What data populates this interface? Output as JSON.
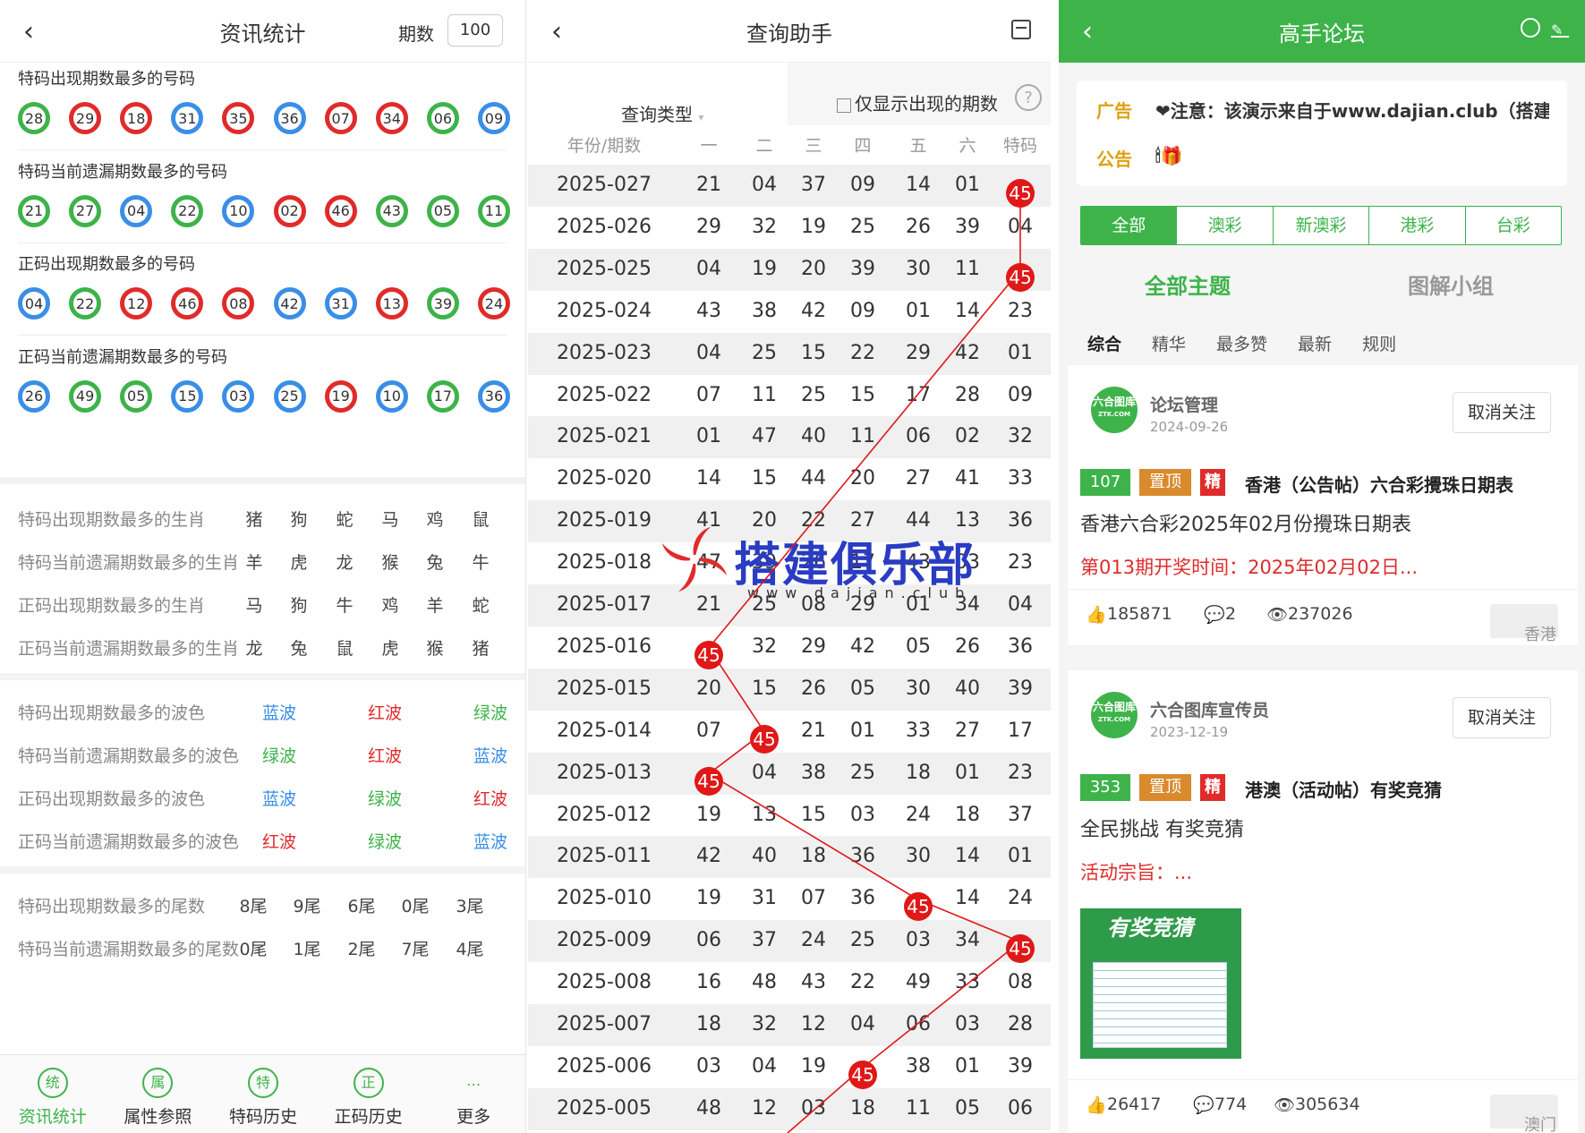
{
  "panel1": {
    "title": "资讯统计",
    "qishu_label": "期数",
    "qishu_value": "100",
    "ball_sections": [
      {
        "title": "特码出现期数最多的号码",
        "balls": [
          [
            "28",
            "green"
          ],
          [
            "29",
            "red"
          ],
          [
            "18",
            "red"
          ],
          [
            "31",
            "blue"
          ],
          [
            "35",
            "red"
          ],
          [
            "36",
            "blue"
          ],
          [
            "07",
            "red"
          ],
          [
            "34",
            "red"
          ],
          [
            "06",
            "green"
          ],
          [
            "09",
            "blue"
          ]
        ]
      },
      {
        "title": "特码当前遗漏期数最多的号码",
        "balls": [
          [
            "21",
            "green"
          ],
          [
            "27",
            "green"
          ],
          [
            "04",
            "blue"
          ],
          [
            "22",
            "green"
          ],
          [
            "10",
            "blue"
          ],
          [
            "02",
            "red"
          ],
          [
            "46",
            "red"
          ],
          [
            "43",
            "green"
          ],
          [
            "05",
            "green"
          ],
          [
            "11",
            "green"
          ]
        ]
      },
      {
        "title": "正码出现期数最多的号码",
        "balls": [
          [
            "04",
            "blue"
          ],
          [
            "22",
            "green"
          ],
          [
            "12",
            "red"
          ],
          [
            "46",
            "red"
          ],
          [
            "08",
            "red"
          ],
          [
            "42",
            "blue"
          ],
          [
            "31",
            "blue"
          ],
          [
            "13",
            "red"
          ],
          [
            "39",
            "green"
          ],
          [
            "24",
            "red"
          ]
        ]
      },
      {
        "title": "正码当前遗漏期数最多的号码",
        "balls": [
          [
            "26",
            "blue"
          ],
          [
            "49",
            "green"
          ],
          [
            "05",
            "green"
          ],
          [
            "15",
            "blue"
          ],
          [
            "03",
            "blue"
          ],
          [
            "25",
            "blue"
          ],
          [
            "19",
            "red"
          ],
          [
            "10",
            "blue"
          ],
          [
            "17",
            "green"
          ],
          [
            "36",
            "blue"
          ]
        ]
      }
    ],
    "zodiac": [
      {
        "label": "特码出现期数最多的生肖",
        "values": [
          "猪",
          "狗",
          "蛇",
          "马",
          "鸡",
          "鼠"
        ]
      },
      {
        "label": "特码当前遗漏期数最多的生肖",
        "values": [
          "羊",
          "虎",
          "龙",
          "猴",
          "兔",
          "牛"
        ]
      },
      {
        "label": "正码出现期数最多的生肖",
        "values": [
          "马",
          "狗",
          "牛",
          "鸡",
          "羊",
          "蛇"
        ]
      },
      {
        "label": "正码当前遗漏期数最多的生肖",
        "values": [
          "龙",
          "兔",
          "鼠",
          "虎",
          "猴",
          "猪"
        ]
      }
    ],
    "waves": [
      {
        "label": "特码出现期数最多的波色",
        "values": [
          [
            "蓝波",
            "blue"
          ],
          [
            "红波",
            "red"
          ],
          [
            "绿波",
            "green"
          ]
        ]
      },
      {
        "label": "特码当前遗漏期数最多的波色",
        "values": [
          [
            "绿波",
            "green"
          ],
          [
            "红波",
            "red"
          ],
          [
            "蓝波",
            "blue"
          ]
        ]
      },
      {
        "label": "正码出现期数最多的波色",
        "values": [
          [
            "蓝波",
            "blue"
          ],
          [
            "绿波",
            "green"
          ],
          [
            "红波",
            "red"
          ]
        ]
      },
      {
        "label": "正码当前遗漏期数最多的波色",
        "values": [
          [
            "红波",
            "red"
          ],
          [
            "绿波",
            "green"
          ],
          [
            "蓝波",
            "blue"
          ]
        ]
      }
    ],
    "tails": [
      {
        "label": "特码出现期数最多的尾数",
        "values": [
          "8尾",
          "9尾",
          "6尾",
          "0尾",
          "3尾"
        ]
      },
      {
        "label": "特码当前遗漏期数最多的尾数",
        "values": [
          "0尾",
          "1尾",
          "2尾",
          "7尾",
          "4尾"
        ]
      }
    ],
    "bottom_nav": [
      {
        "icon": "统",
        "label": "资讯统计"
      },
      {
        "icon": "属",
        "label": "属性参照"
      },
      {
        "icon": "特",
        "label": "特码历史"
      },
      {
        "icon": "正",
        "label": "正码历史"
      },
      {
        "icon": "…",
        "label": "更多"
      }
    ]
  },
  "panel2": {
    "title": "查询助手",
    "query_type": "查询类型",
    "checkbox_label": "仅显示出现的期数",
    "help": "?",
    "headers": [
      "年份/期数",
      "一",
      "二",
      "三",
      "四",
      "五",
      "六",
      "特码"
    ],
    "highlight": "45",
    "rows": [
      [
        "2025-027",
        "21",
        "04",
        "37",
        "09",
        "14",
        "01",
        "45"
      ],
      [
        "2025-026",
        "29",
        "32",
        "19",
        "25",
        "26",
        "39",
        "04"
      ],
      [
        "2025-025",
        "04",
        "19",
        "20",
        "39",
        "30",
        "11",
        "45"
      ],
      [
        "2025-024",
        "43",
        "38",
        "42",
        "09",
        "01",
        "14",
        "23"
      ],
      [
        "2025-023",
        "04",
        "25",
        "15",
        "22",
        "29",
        "42",
        "01"
      ],
      [
        "2025-022",
        "07",
        "11",
        "25",
        "15",
        "17",
        "28",
        "09"
      ],
      [
        "2025-021",
        "01",
        "47",
        "40",
        "11",
        "06",
        "02",
        "32"
      ],
      [
        "2025-020",
        "14",
        "15",
        "44",
        "20",
        "27",
        "41",
        "33"
      ],
      [
        "2025-019",
        "41",
        "20",
        "22",
        "27",
        "44",
        "13",
        "36"
      ],
      [
        "2025-018",
        "47",
        "39",
        "26",
        "17",
        "43",
        "03",
        "23"
      ],
      [
        "2025-017",
        "21",
        "25",
        "08",
        "29",
        "01",
        "34",
        "04"
      ],
      [
        "2025-016",
        "45",
        "32",
        "29",
        "42",
        "05",
        "26",
        "36"
      ],
      [
        "2025-015",
        "20",
        "15",
        "26",
        "05",
        "30",
        "40",
        "39"
      ],
      [
        "2025-014",
        "07",
        "45",
        "21",
        "01",
        "33",
        "27",
        "17"
      ],
      [
        "2025-013",
        "45",
        "04",
        "38",
        "25",
        "18",
        "01",
        "23"
      ],
      [
        "2025-012",
        "19",
        "13",
        "15",
        "03",
        "24",
        "18",
        "37"
      ],
      [
        "2025-011",
        "42",
        "40",
        "18",
        "36",
        "30",
        "14",
        "01"
      ],
      [
        "2025-010",
        "19",
        "31",
        "07",
        "36",
        "45",
        "14",
        "24"
      ],
      [
        "2025-009",
        "06",
        "37",
        "24",
        "25",
        "03",
        "34",
        "45"
      ],
      [
        "2025-008",
        "16",
        "48",
        "43",
        "22",
        "49",
        "33",
        "08"
      ],
      [
        "2025-007",
        "18",
        "32",
        "12",
        "04",
        "06",
        "03",
        "28"
      ],
      [
        "2025-006",
        "03",
        "04",
        "19",
        "45",
        "38",
        "01",
        "39"
      ],
      [
        "2025-005",
        "48",
        "12",
        "03",
        "18",
        "11",
        "05",
        "06"
      ]
    ],
    "watermark_title": "搭建俱乐部",
    "watermark_url": "www.dajian.club"
  },
  "panel3": {
    "title": "高手论坛",
    "ad_label": "广告",
    "ad_text": "❤注意：该演示来自于www.dajian.club（搭建",
    "notice_label": "公告",
    "notice_text": "🕯🎁",
    "tabs": [
      "全部",
      "澳彩",
      "新澳彩",
      "港彩",
      "台彩"
    ],
    "main_tabs": [
      "全部主题",
      "图解小组"
    ],
    "sub_tabs": [
      "综合",
      "精华",
      "最多赞",
      "最新",
      "规则"
    ],
    "posts": [
      {
        "avatar": "六合图库",
        "avatar_sub": "ZTK.COM",
        "user": "论坛管理",
        "date": "2024-09-26",
        "follow": "取消关注",
        "num": "107",
        "top": "置顶",
        "jing": "精",
        "title": "香港（公告帖）六合彩攪珠日期表",
        "line1": "香港六合彩2025年02月份攪珠日期表",
        "line2": "第013期开奖时间：2025年02月02日...",
        "likes": "185871",
        "comments": "2",
        "views": "237026",
        "region": "香港"
      },
      {
        "avatar": "六合图库",
        "avatar_sub": "ZTK.COM",
        "user": "六合图库宣传员",
        "date": "2023-12-19",
        "follow": "取消关注",
        "num": "353",
        "top": "置顶",
        "jing": "精",
        "title": "港澳（活动帖）有奖竞猜",
        "line1": "全民挑战 有奖竞猜",
        "line2": "活动宗旨：...",
        "image_title": "有奖竞猜",
        "likes": "26417",
        "comments": "774",
        "views": "305634",
        "region": "澳门"
      }
    ]
  },
  "colors": {
    "green": "#3db34a",
    "red": "#e02b2b",
    "blue": "#3a8ee6"
  }
}
